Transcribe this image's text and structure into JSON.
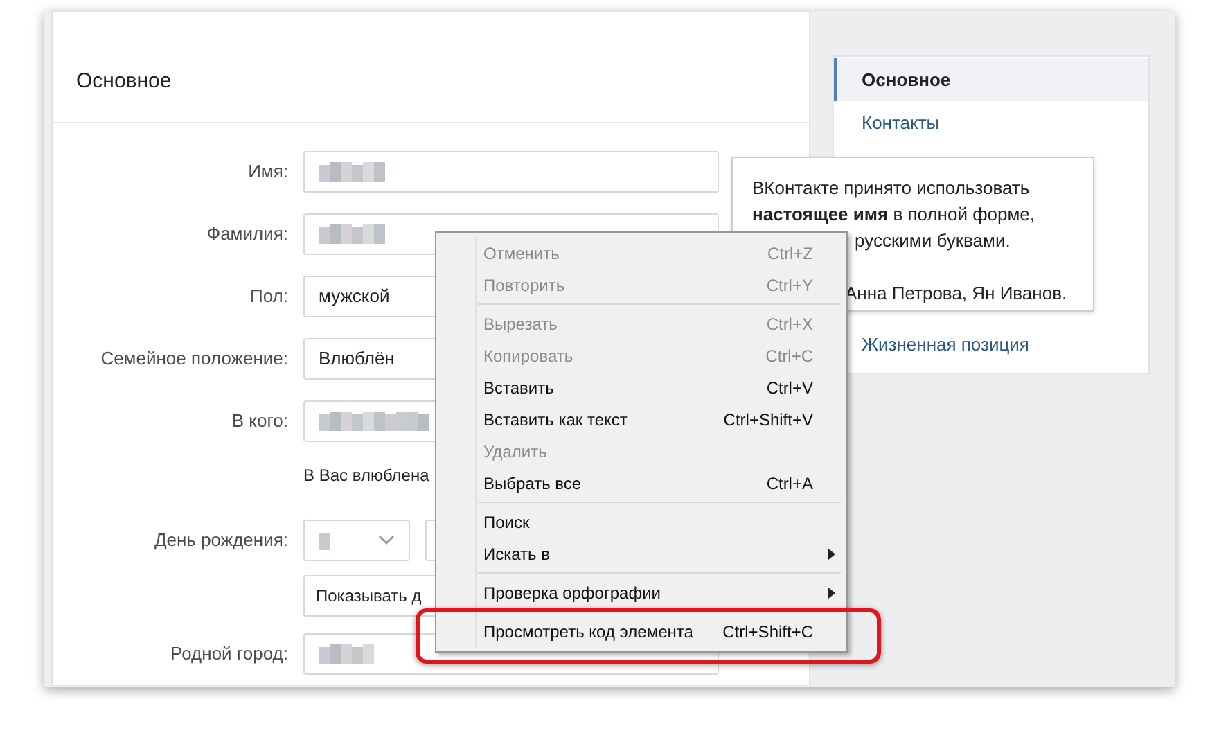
{
  "main": {
    "title": "Основное",
    "rows": [
      {
        "label": "Имя:",
        "kind": "blurred"
      },
      {
        "label": "Фамилия:",
        "kind": "blurred"
      },
      {
        "label": "Пол:",
        "kind": "text",
        "value": "мужской"
      },
      {
        "label": "Семейное положение:",
        "kind": "text",
        "value": "Влюблён"
      },
      {
        "label": "В кого:",
        "kind": "blurred"
      }
    ],
    "note": "В Вас влюблена",
    "birthday": {
      "label": "День рождения:",
      "show_select": "Показывать д"
    },
    "hometown": {
      "label": "Родной город:"
    }
  },
  "sidebar": {
    "items": [
      {
        "label": "Основное",
        "selected": true
      },
      {
        "label": "Контакты",
        "selected": false
      },
      {
        "label": "Жизненная позиция",
        "selected": false
      }
    ]
  },
  "tooltip": {
    "lines": [
      "ВКонтакте принято использовать",
      "**настоящее имя** в полной форме,",
      "русскими буквами.",
      "Анна Петрова, Ян Иванов."
    ]
  },
  "context_menu": {
    "items": [
      {
        "kind": "item",
        "label": "Отменить",
        "shortcut": "Ctrl+Z",
        "disabled": true
      },
      {
        "kind": "item",
        "label": "Повторить",
        "shortcut": "Ctrl+Y",
        "disabled": true
      },
      {
        "kind": "separator"
      },
      {
        "kind": "item",
        "label": "Вырезать",
        "shortcut": "Ctrl+X",
        "disabled": true
      },
      {
        "kind": "item",
        "label": "Копировать",
        "shortcut": "Ctrl+C",
        "disabled": true
      },
      {
        "kind": "item",
        "label": "Вставить",
        "shortcut": "Ctrl+V",
        "disabled": false
      },
      {
        "kind": "item",
        "label": "Вставить как текст",
        "shortcut": "Ctrl+Shift+V",
        "disabled": false
      },
      {
        "kind": "item",
        "label": "Удалить",
        "disabled": true
      },
      {
        "kind": "item",
        "label": "Выбрать все",
        "shortcut": "Ctrl+A",
        "disabled": false
      },
      {
        "kind": "separator"
      },
      {
        "kind": "item",
        "label": "Поиск",
        "disabled": false
      },
      {
        "kind": "submenu",
        "label": "Искать в",
        "disabled": false
      },
      {
        "kind": "separator"
      },
      {
        "kind": "submenu",
        "label": "Проверка орфографии",
        "disabled": false
      },
      {
        "kind": "separator"
      },
      {
        "kind": "item",
        "label": "Просмотреть код элемента",
        "shortcut": "Ctrl+Shift+C",
        "disabled": false,
        "highlighted": true
      }
    ]
  }
}
